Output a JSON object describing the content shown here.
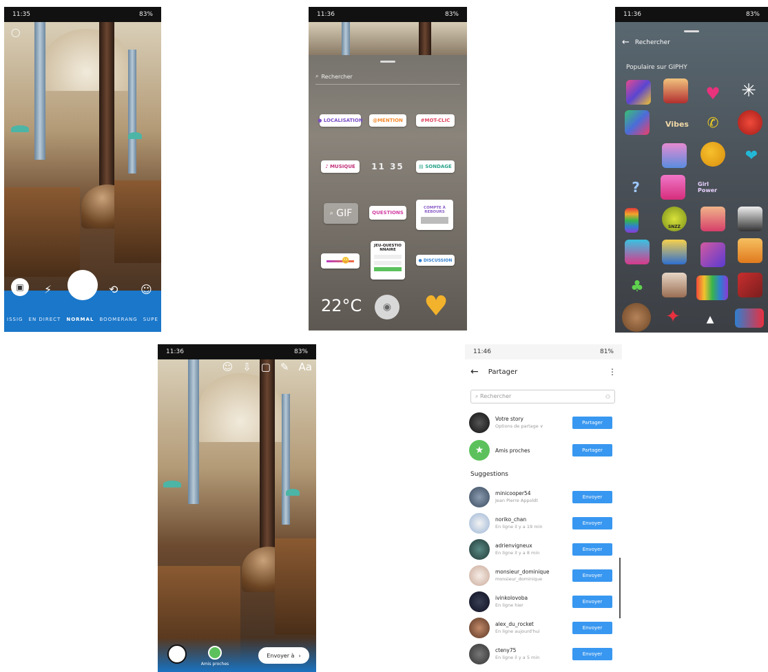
{
  "phone1": {
    "status_time": "11:35",
    "status_right": "83%",
    "modes": [
      "ISSIG",
      "EN DIRECT",
      "NORMAL",
      "BOOMERANG",
      "SUPE"
    ],
    "active_mode": "NORMAL"
  },
  "phone2": {
    "status_time": "11:36",
    "status_right": "83%",
    "search_placeholder": "Rechercher",
    "stickers": {
      "location": "LOCALISATION",
      "mention": "@MENTION",
      "hashtag": "#MOT-CLIC",
      "music": "MUSIQUE",
      "time": "11 35",
      "poll": "SONDAGE",
      "gif": "GIF",
      "questions": "QUESTIONS",
      "countdown": "COMPTE À REBOURS",
      "quiz": "JEU-QUESTIO NNAIRE",
      "chat": "DISCUSSION",
      "temperature": "22°C"
    }
  },
  "phone3": {
    "status_time": "11:36",
    "status_right": "83%",
    "back_label": "Rechercher",
    "section_title": "Populaire sur GIPHY",
    "gif_texts": {
      "vibes": "Vibes",
      "girlpower": "Girl Power",
      "sleepy": "SNZZ"
    }
  },
  "phone4": {
    "status_time": "11:36",
    "status_right": "83%",
    "top_text": "Aa",
    "close_friends_label": "Amis proches",
    "send_label": "Envoyer à"
  },
  "phone5": {
    "status_time": "11:46",
    "status_right": "81%",
    "title": "Partager",
    "search_placeholder": "Rechercher",
    "your_story": {
      "name": "Votre story",
      "sub": "Options de partage ∨",
      "button": "Partager"
    },
    "close_friends": {
      "name": "Amis proches",
      "button": "Partager"
    },
    "suggestions_title": "Suggestions",
    "send_label": "Envoyer",
    "contacts": [
      {
        "name": "minicooper54",
        "sub": "Jean Pierre Appoldt"
      },
      {
        "name": "noriko_chan",
        "sub": "En ligne il y a 19 min"
      },
      {
        "name": "adrienvigneux",
        "sub": "En ligne il y a 8 min"
      },
      {
        "name": "monsieur_dominique",
        "sub": "monsieur_dominique"
      },
      {
        "name": "ivinkolovoba",
        "sub": "En ligne hier"
      },
      {
        "name": "alex_du_rocket",
        "sub": "En ligne aujourd'hui"
      },
      {
        "name": "cteny75",
        "sub": "En ligne il y a 5 min"
      }
    ]
  }
}
